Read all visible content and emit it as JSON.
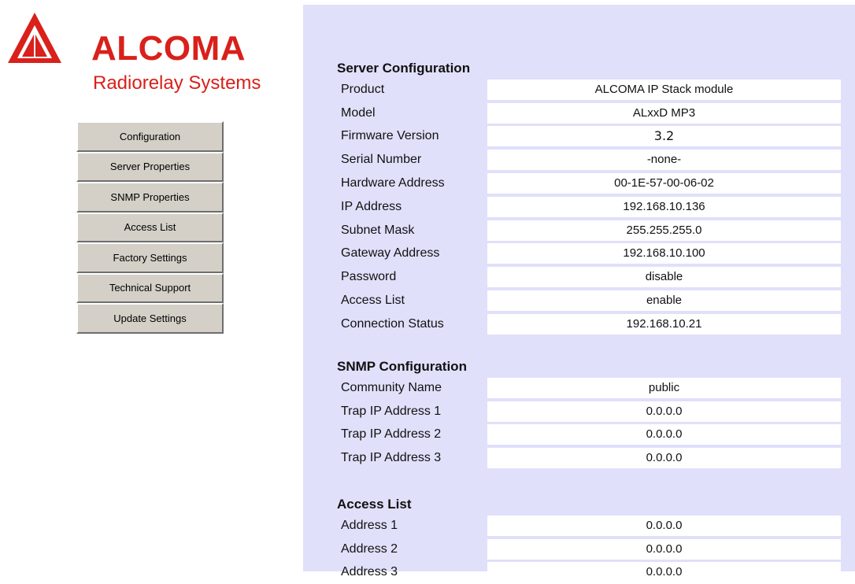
{
  "brand": {
    "name": "ALCOMA",
    "subtitle": "Radiorelay Systems",
    "color": "#d9201b"
  },
  "menu": {
    "items": [
      {
        "label": "Configuration"
      },
      {
        "label": "Server Properties"
      },
      {
        "label": "SNMP Properties"
      },
      {
        "label": "Access List"
      },
      {
        "label": "Factory Settings"
      },
      {
        "label": "Technical Support"
      },
      {
        "label": "Update Settings"
      }
    ]
  },
  "server": {
    "title": "Server Configuration",
    "rows": [
      {
        "label": "Product",
        "value": "ALCOMA IP Stack module"
      },
      {
        "label": "Model",
        "value": "ALxxD MP3"
      },
      {
        "label": "Firmware Version",
        "value": "3.2"
      },
      {
        "label": "Serial Number",
        "value": "-none-"
      },
      {
        "label": "Hardware Address",
        "value": "00-1E-57-00-06-02"
      },
      {
        "label": "IP Address",
        "value": "192.168.10.136"
      },
      {
        "label": "Subnet Mask",
        "value": "255.255.255.0"
      },
      {
        "label": "Gateway Address",
        "value": "192.168.10.100"
      },
      {
        "label": "Password",
        "value": "disable"
      },
      {
        "label": "Access List",
        "value": "enable"
      },
      {
        "label": "Connection Status",
        "value": "192.168.10.21"
      }
    ]
  },
  "snmp": {
    "title": "SNMP Configuration",
    "rows": [
      {
        "label": "Community Name",
        "value": "public"
      },
      {
        "label": "Trap IP Address 1",
        "value": "0.0.0.0"
      },
      {
        "label": "Trap IP Address 2",
        "value": "0.0.0.0"
      },
      {
        "label": "Trap IP Address 3",
        "value": "0.0.0.0"
      }
    ]
  },
  "access": {
    "title": "Access List",
    "rows": [
      {
        "label": "Address 1",
        "value": "0.0.0.0"
      },
      {
        "label": "Address 2",
        "value": "0.0.0.0"
      },
      {
        "label": "Address 3",
        "value": "0.0.0.0"
      }
    ]
  },
  "colors": {
    "panel_bg": "#e0e0fb",
    "button_face": "#d4d0c8"
  }
}
